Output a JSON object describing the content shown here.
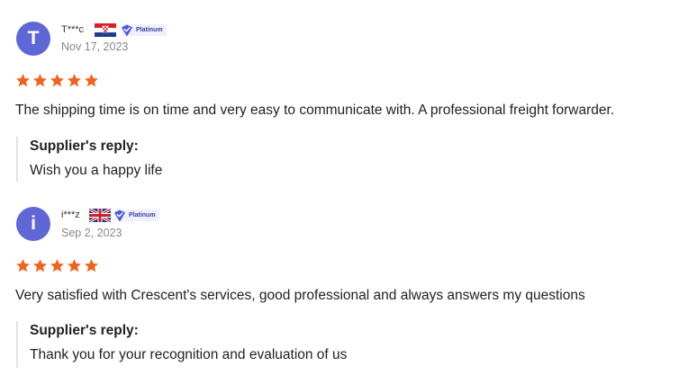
{
  "reviews": [
    {
      "avatar_letter": "T",
      "username": "T***c",
      "country_flag": "croatia-flag",
      "badge": "Platinum",
      "date": "Nov 17, 2023",
      "rating": 5,
      "comment": "The shipping time is on time and very easy to communicate with. A professional freight forwarder.",
      "reply_title": "Supplier's reply:",
      "reply_text": "Wish you a happy life"
    },
    {
      "avatar_letter": "i",
      "username": "i***z",
      "country_flag": "united-kingdom-flag",
      "badge": "Platinum",
      "date": "Sep 2, 2023",
      "rating": 5,
      "comment": "Very satisfied with Crescent's services, good professional and always answers my questions",
      "reply_title": "Supplier's reply:",
      "reply_text": "Thank you for your recognition and evaluation of us"
    }
  ],
  "colors": {
    "avatar": "#5f66d6",
    "star": "#f2621f",
    "badge_bg": "#eef0ff",
    "badge_icon": "#4a56e2"
  }
}
